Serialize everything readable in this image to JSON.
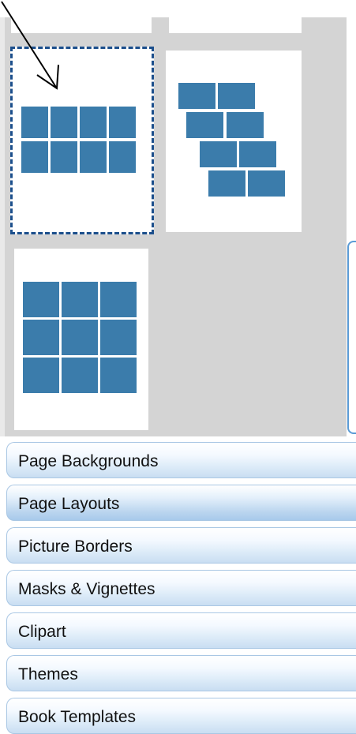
{
  "layout_thumbnails": [
    {
      "name": "layout-4x2-grid",
      "selected": true
    },
    {
      "name": "layout-staggered-bricks",
      "selected": false
    },
    {
      "name": "layout-3x3-grid",
      "selected": false
    }
  ],
  "colors": {
    "tile": "#3b7cab",
    "selection_dashes": "#1c4f8c",
    "panel_bg": "#d4d4d4",
    "accordion_border": "#a9c7e4"
  },
  "accordion": {
    "items": [
      {
        "label": "Page Backgrounds"
      },
      {
        "label": "Page Layouts",
        "active": true
      },
      {
        "label": "Picture Borders"
      },
      {
        "label": "Masks & Vignettes"
      },
      {
        "label": "Clipart"
      },
      {
        "label": "Themes"
      },
      {
        "label": "Book Templates"
      }
    ]
  },
  "icons": {
    "pointer": "arrow-pointer-icon"
  }
}
